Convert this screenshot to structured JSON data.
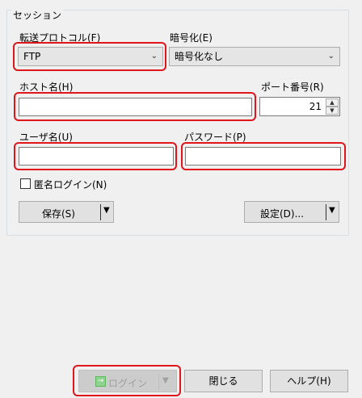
{
  "session": {
    "group_title": "セッション",
    "protocol": {
      "label": "転送プロトコル(F)",
      "value": "FTP"
    },
    "encryption": {
      "label": "暗号化(E)",
      "value": "暗号化なし"
    },
    "host": {
      "label": "ホスト名(H)",
      "value": ""
    },
    "port": {
      "label": "ポート番号(R)",
      "value": "21"
    },
    "user": {
      "label": "ユーザ名(U)",
      "value": ""
    },
    "password": {
      "label": "パスワード(P)",
      "value": ""
    },
    "anonymous": {
      "label": "匿名ログイン(N)",
      "checked": false
    },
    "save_button": "保存(S)",
    "advanced_button": "設定(D)..."
  },
  "footer": {
    "login_button": "ログイン",
    "close_button": "閉じる",
    "help_button": "ヘルプ(H)"
  },
  "colors": {
    "highlight": "#e0161c",
    "background": "#f0f0f0"
  },
  "icons": {
    "dropdown": "chevron-down-icon",
    "login": "login-icon"
  }
}
